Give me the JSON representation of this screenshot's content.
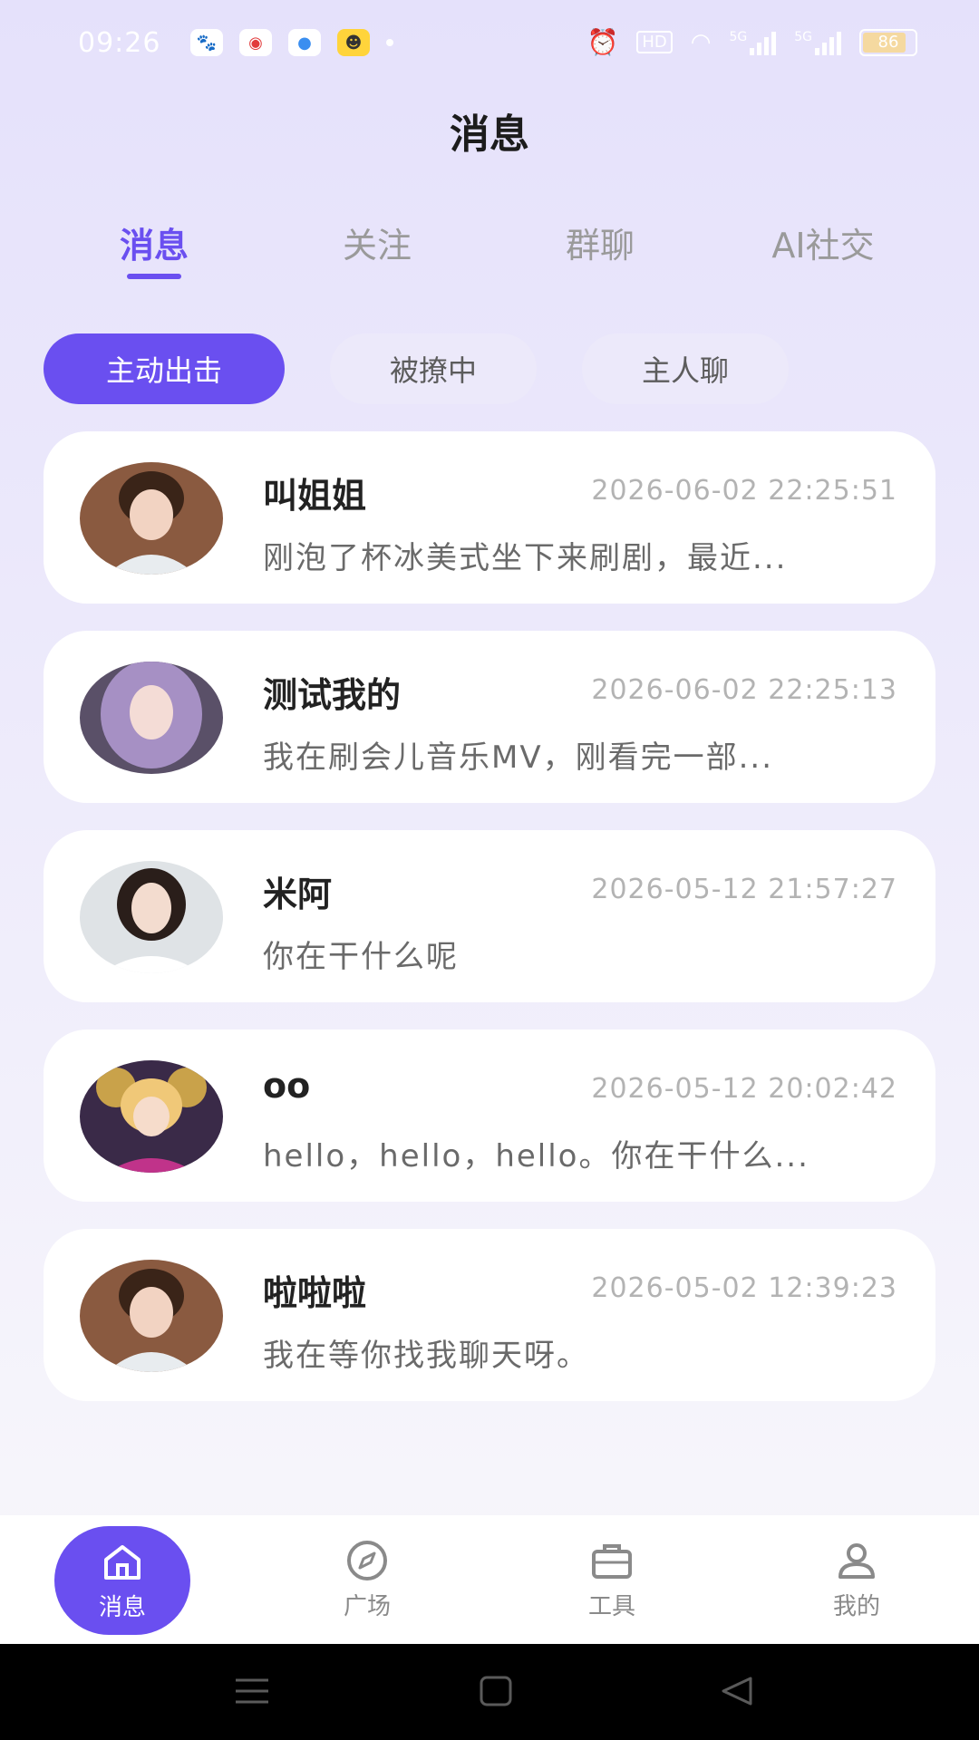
{
  "status_bar": {
    "time": "09:26",
    "app_icons": [
      "baidu-icon",
      "browser-icon",
      "sphere-icon",
      "game-icon"
    ],
    "network_labels": [
      "HD",
      "5G",
      "5G"
    ],
    "battery": "86"
  },
  "header": {
    "title": "消息"
  },
  "tabs": [
    {
      "label": "消息",
      "active": true
    },
    {
      "label": "关注",
      "active": false
    },
    {
      "label": "群聊",
      "active": false
    },
    {
      "label": "AI社交",
      "active": false
    }
  ],
  "filters": [
    {
      "label": "主动出击",
      "active": true
    },
    {
      "label": "被撩中",
      "active": false
    },
    {
      "label": "主人聊",
      "active": false
    }
  ],
  "messages": [
    {
      "name": "叫姐姐",
      "time": "2026-06-02 22:25:51",
      "preview": "刚泡了杯冰美式坐下来刷剧，最近..."
    },
    {
      "name": "测试我的",
      "time": "2026-06-02 22:25:13",
      "preview": "我在刷会儿音乐MV，刚看完一部..."
    },
    {
      "name": "米阿",
      "time": "2026-05-12 21:57:27",
      "preview": "你在干什么呢"
    },
    {
      "name": "oo",
      "time": "2026-05-12 20:02:42",
      "preview": "hello，hello，hello。你在干什么..."
    },
    {
      "name": "啦啦啦",
      "time": "2026-05-02 12:39:23",
      "preview": "我在等你找我聊天呀。"
    }
  ],
  "bottom_nav": [
    {
      "label": "消息",
      "icon": "home-icon",
      "active": true
    },
    {
      "label": "广场",
      "icon": "compass-icon",
      "active": false
    },
    {
      "label": "工具",
      "icon": "toolbox-icon",
      "active": false
    },
    {
      "label": "我的",
      "icon": "user-icon",
      "active": false
    }
  ],
  "colors": {
    "accent": "#6a4ff0",
    "chip_inactive": "#ece9fa",
    "card": "#ffffff"
  }
}
